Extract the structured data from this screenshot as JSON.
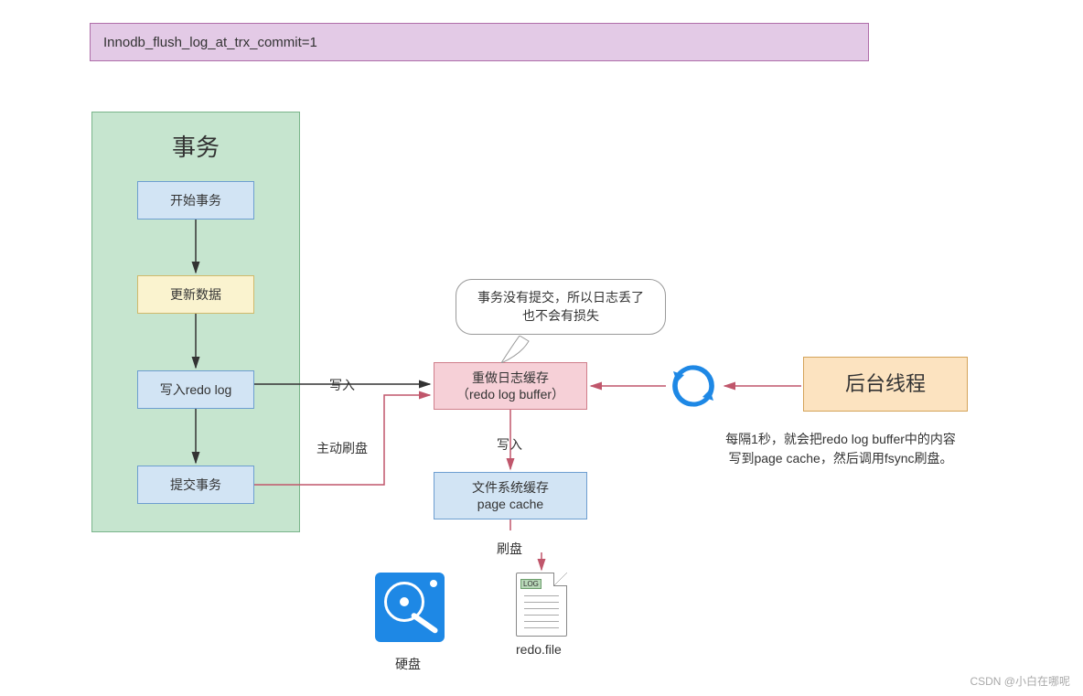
{
  "header": {
    "title": "Innodb_flush_log_at_trx_commit=1"
  },
  "transaction": {
    "title": "事务",
    "steps": {
      "start": "开始事务",
      "update": "更新数据",
      "redo": "写入redo log",
      "commit": "提交事务"
    }
  },
  "buffer": {
    "line1": "重做日志缓存",
    "line2": "（redo log buffer）"
  },
  "pagecache": {
    "line1": "文件系统缓存",
    "line2": "page cache"
  },
  "bgthread": {
    "label": "后台线程"
  },
  "bubble": {
    "line1": "事务没有提交，所以日志丢了",
    "line2": "也不会有损失"
  },
  "desc": {
    "line1": "每隔1秒，就会把redo log buffer中的内容",
    "line2": "写到page cache，然后调用fsync刷盘。"
  },
  "edges": {
    "write1": "写入",
    "activeFlush": "主动刷盘",
    "write2": "写入",
    "flush": "刷盘"
  },
  "disk": {
    "label": "硬盘"
  },
  "file": {
    "label": "redo.file",
    "tag": "LOG"
  },
  "icons": {
    "cycle": "refresh-cycle-icon",
    "disk": "disk-icon",
    "file": "log-file-icon"
  },
  "watermark": "CSDN @小白在哪呢",
  "colors": {
    "blue": "#d2e4f4",
    "yellow": "#faf3cf",
    "pink": "#f6d0d7",
    "orange": "#fce3c0",
    "green": "#c6e5cf",
    "purple": "#e3cae6",
    "arrowBlack": "#333333",
    "arrowRed": "#c0566b",
    "cycleBlue": "#1e88e5"
  }
}
